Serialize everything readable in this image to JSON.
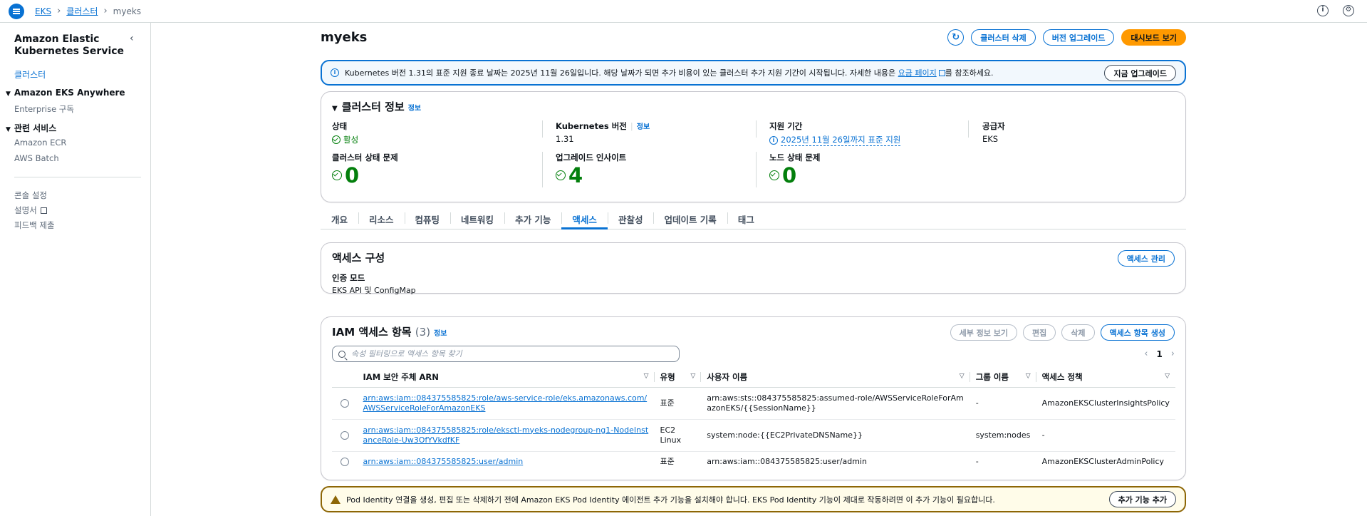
{
  "topbar": {
    "breadcrumbs": [
      "EKS",
      "클러스터",
      "myeks"
    ]
  },
  "sidenav": {
    "service_title": "Amazon Elastic Kubernetes Service",
    "clusters": "클러스터",
    "eks_anywhere": "Amazon EKS Anywhere",
    "enterprise": "Enterprise 구독",
    "related": "관련 서비스",
    "ecr": "Amazon ECR",
    "batch": "AWS Batch",
    "console_settings": "콘솔 설정",
    "docs": "설명서",
    "feedback": "피드백 제출"
  },
  "header": {
    "title": "myeks",
    "delete": "클러스터 삭제",
    "upgrade": "버전 업그레이드",
    "dashboard": "대시보드 보기"
  },
  "info_alert": {
    "text_before": "Kubernetes 버전 1.31의 표준 지원 종료 날짜는 2025년 11월 26일입니다. 해당 날짜가 되면 추가 비용이 있는 클러스터 추가 지원 기간이 시작됩니다. 자세한 내용은 ",
    "link": "요금 페이지",
    "text_after": "를 참조하세요.",
    "button": "지금 업그레이드"
  },
  "cluster_info": {
    "title": "클러스터 정보",
    "info": "정보",
    "status_label": "상태",
    "status_value": "활성",
    "k8s_label": "Kubernetes 버전",
    "k8s_info": "정보",
    "k8s_value": "1.31",
    "support_label": "지원 기간",
    "support_value": "2025년 11월 26일까지 표준 지원",
    "provider_label": "공급자",
    "provider_value": "EKS",
    "health_label": "클러스터 상태 문제",
    "health_value": "0",
    "insights_label": "업그레이드 인사이트",
    "insights_value": "4",
    "node_label": "노드 상태 문제",
    "node_value": "0"
  },
  "tabs": [
    "개요",
    "리소스",
    "컴퓨팅",
    "네트워킹",
    "추가 기능",
    "액세스",
    "관찰성",
    "업데이트 기록",
    "태그"
  ],
  "access_config": {
    "title": "액세스 구성",
    "manage": "액세스 관리",
    "auth_label": "인증 모드",
    "auth_value": "EKS API 및 ConfigMap"
  },
  "iam": {
    "title": "IAM 액세스 항목",
    "count": "(3)",
    "info": "정보",
    "details": "세부 정보 보기",
    "edit": "편집",
    "delete": "삭제",
    "create": "액세스 항목 생성",
    "search_placeholder": "속성 필터링으로 액세스 항목 찾기",
    "page": "1",
    "columns": [
      "IAM 보안 주체 ARN",
      "유형",
      "사용자 이름",
      "그룹 이름",
      "액세스 정책"
    ],
    "rows": [
      {
        "arn": "arn:aws:iam::084375585825:role/aws-service-role/eks.amazonaws.com/AWSServiceRoleForAmazonEKS",
        "type": "표준",
        "user": "arn:aws:sts::084375585825:assumed-role/AWSServiceRoleForAmazonEKS/{{SessionName}}",
        "group": "-",
        "policy": "AmazonEKSClusterInsightsPolicy"
      },
      {
        "arn": "arn:aws:iam::084375585825:role/eksctl-myeks-nodegroup-ng1-NodeInstanceRole-Uw3OfYVkdfKF",
        "type": "EC2 Linux",
        "user": "system:node:{{EC2PrivateDNSName}}",
        "group": "system:nodes",
        "policy": "-"
      },
      {
        "arn": "arn:aws:iam::084375585825:user/admin",
        "type": "표준",
        "user": "arn:aws:iam::084375585825:user/admin",
        "group": "-",
        "policy": "AmazonEKSClusterAdminPolicy"
      }
    ]
  },
  "pod_alert": {
    "text": "Pod Identity 연결을 생성, 편집 또는 삭제하기 전에 Amazon EKS Pod Identity 에이전트 추가 기능을 설치해야 합니다. EKS Pod Identity 기능이 제대로 작동하려면 이 추가 기능이 필요합니다.",
    "button": "추가 기능 추가"
  }
}
